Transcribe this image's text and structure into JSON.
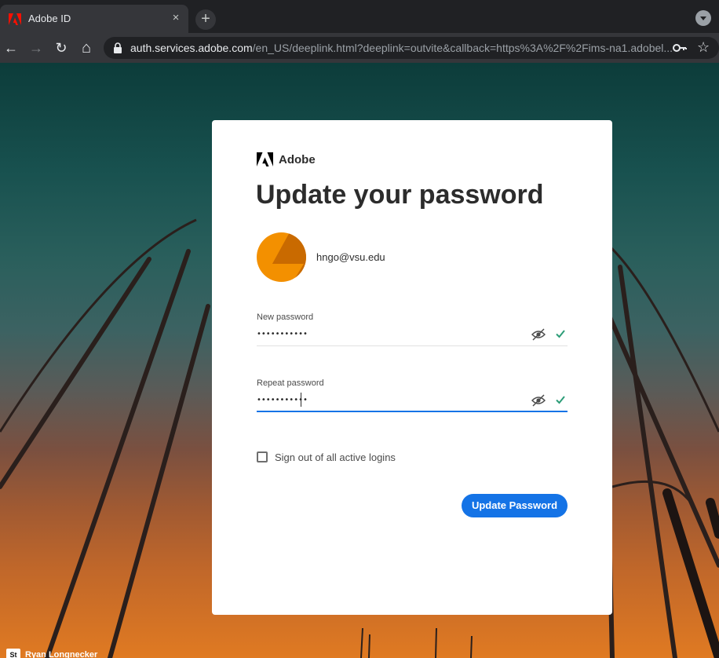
{
  "browser": {
    "tab_title": "Adobe ID",
    "tab_close": "×",
    "new_tab": "+",
    "back": "←",
    "forward": "→",
    "reload": "↻",
    "home": "⌂",
    "url_host": "auth.services.adobe.com",
    "url_path": "/en_US/deeplink.html?deeplink=outvite&callback=https%3A%2F%2Fims-na1.adobel...",
    "star": "☆"
  },
  "card": {
    "brand": "Adobe",
    "heading": "Update your password",
    "account_email": "hngo@vsu.edu",
    "new_password": {
      "label": "New password",
      "value": "•••••••••••",
      "valid": true
    },
    "repeat_password": {
      "label": "Repeat password",
      "value": "•••••••••••",
      "valid": true,
      "focused": true
    },
    "sign_out_checkbox": {
      "label": "Sign out of all active logins",
      "checked": false
    },
    "submit_label": "Update Password"
  },
  "background": {
    "credit_badge": "St",
    "credit_name": "Ryan Longnecker"
  },
  "colors": {
    "accent": "#1473e6",
    "valid_check": "#2d9d78",
    "avatar_orange": "#f39000",
    "adobe_red": "#fa0f00"
  }
}
